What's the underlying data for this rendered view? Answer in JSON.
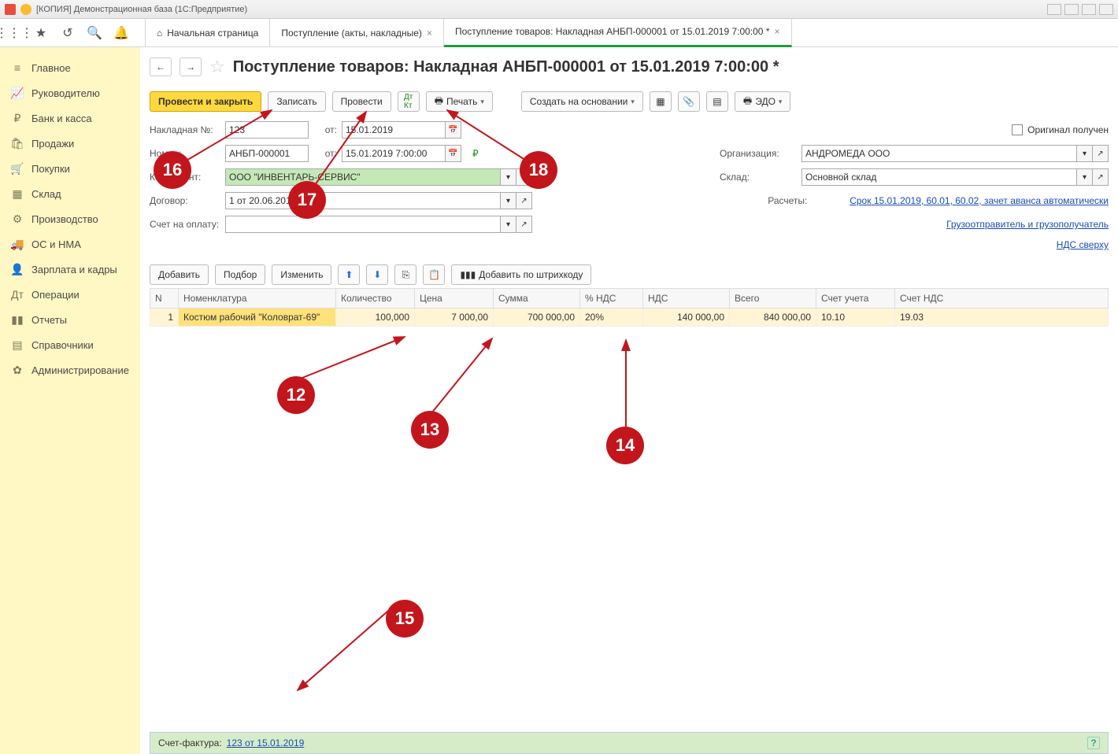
{
  "title": "[КОПИЯ] Демонстрационная база  (1С:Предприятие)",
  "tabs": {
    "home": "Начальная страница",
    "list": "Поступление (акты, накладные)",
    "doc": "Поступление товаров: Накладная АНБП-000001 от 15.01.2019 7:00:00 *"
  },
  "sidebar": [
    "Главное",
    "Руководителю",
    "Банк и касса",
    "Продажи",
    "Покупки",
    "Склад",
    "Производство",
    "ОС и НМА",
    "Зарплата и кадры",
    "Операции",
    "Отчеты",
    "Справочники",
    "Администрирование"
  ],
  "pageTitle": "Поступление товаров: Накладная АНБП-000001 от 15.01.2019 7:00:00 *",
  "buttons": {
    "post_close": "Провести и закрыть",
    "save": "Записать",
    "post": "Провести",
    "print": "Печать",
    "create_based": "Создать на основании",
    "edo": "ЭДО",
    "add": "Добавить",
    "select": "Подбор",
    "change": "Изменить",
    "add_barcode": "Добавить по штрихкоду"
  },
  "labels": {
    "invoice_no": "Накладная №:",
    "from": "от:",
    "number": "Номер:",
    "from2": "от:",
    "counterparty": "Контрагент:",
    "contract": "Договор:",
    "bill": "Счет на оплату:",
    "original": "Оригинал получен",
    "organization": "Организация:",
    "warehouse": "Склад:",
    "settlements": "Расчеты:",
    "invoice_factura": "Счет-фактура:"
  },
  "values": {
    "invoice_no": "123",
    "invoice_date": "15.01.2019",
    "number": "АНБП-000001",
    "datetime": "15.01.2019  7:00:00",
    "counterparty": "ООО \"ИНВЕНТАРЬ-СЕРВИС\"",
    "contract": "1 от 20.06.2015",
    "organization": "АНДРОМЕДА ООО",
    "warehouse": "Основной склад",
    "settlements": "Срок 15.01.2019, 60.01, 60.02, зачет аванса автоматически",
    "shipper": "Грузоотправитель и грузополучатель",
    "vat_mode": "НДС сверху",
    "invoice_factura": "123 от 15.01.2019"
  },
  "table": {
    "headers": [
      "N",
      "Номенклатура",
      "Количество",
      "Цена",
      "Сумма",
      "% НДС",
      "НДС",
      "Всего",
      "Счет учета",
      "Счет НДС"
    ],
    "row": {
      "n": "1",
      "nomenclature": "Костюм рабочий \"Коловрат-69\"",
      "qty": "100,000",
      "price": "7 000,00",
      "sum": "700 000,00",
      "vat_pct": "20%",
      "vat": "140 000,00",
      "total": "840 000,00",
      "acct": "10.10",
      "vat_acct": "19.03"
    }
  },
  "annotations": {
    "a12": "12",
    "a13": "13",
    "a14": "14",
    "a15": "15",
    "a16": "16",
    "a17": "17",
    "a18": "18"
  }
}
